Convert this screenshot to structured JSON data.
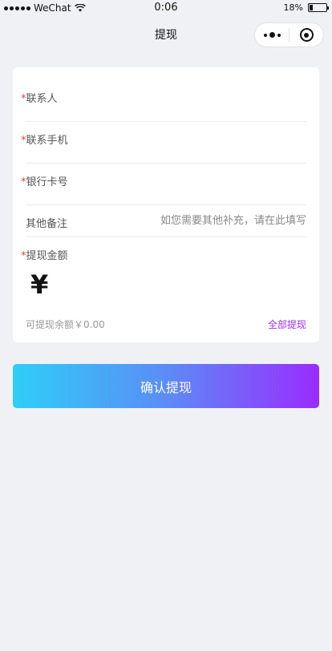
{
  "status_bar": {
    "carrier": "WeChat",
    "time": "0:06",
    "battery_percent": "18%",
    "battery_level": 0.18
  },
  "nav": {
    "title": "提现",
    "more_icon": "more-dots-icon",
    "close_icon": "target-close-icon"
  },
  "form": {
    "contact": {
      "required_mark": "*",
      "label": "联系人",
      "value": ""
    },
    "phone": {
      "required_mark": "*",
      "label": "联系手机",
      "value": ""
    },
    "bank_card": {
      "required_mark": "*",
      "label": "银行卡号",
      "value": ""
    },
    "remark": {
      "label": "其他备注",
      "placeholder": "如您需要其他补充，请在此填写",
      "value": ""
    },
    "amount": {
      "required_mark": "*",
      "label": "提现金额",
      "currency_symbol": "¥",
      "value": ""
    },
    "available_balance": "可提现余额￥0.00",
    "withdraw_all": "全部提现"
  },
  "submit_label": "确认提现",
  "colors": {
    "required": "#e64340",
    "link": "#9b30ff",
    "button_gradient_start": "#2ecff7",
    "button_gradient_end": "#9a2cff",
    "background": "#f0f1f5"
  }
}
